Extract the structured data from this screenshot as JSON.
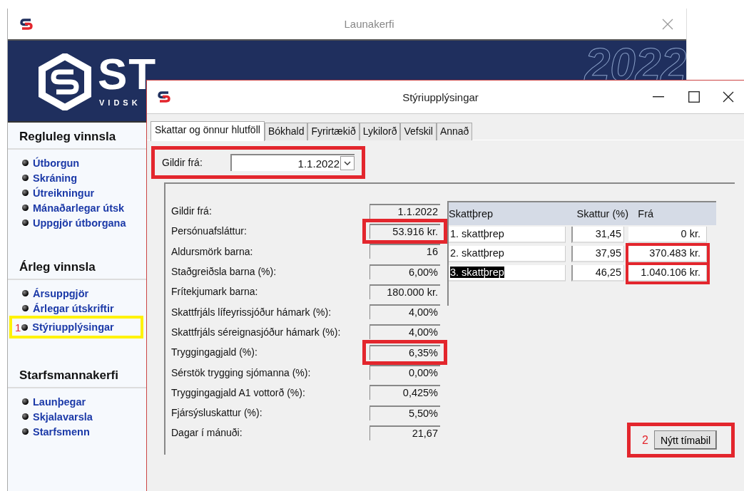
{
  "main_window": {
    "title": "Launakerfi"
  },
  "banner": {
    "brand": "ST",
    "tagline": "VIDSK",
    "year": "2022"
  },
  "sidebar": {
    "sections": [
      {
        "heading": "Regluleg vinnsla",
        "items": [
          {
            "label": "Útborgun"
          },
          {
            "label": "Skráning"
          },
          {
            "label": "Útreikningur"
          },
          {
            "label": "Mánaðarlegar útsk"
          },
          {
            "label": "Uppgjör útborgana"
          }
        ]
      },
      {
        "heading": "Árleg vinnsla",
        "items": [
          {
            "label": "Ársuppgjör"
          },
          {
            "label": "Árlegar útskriftir"
          },
          {
            "label": "Stýriupplýsingar",
            "callout": "1",
            "highlighted": true
          }
        ]
      },
      {
        "heading": "Starfsmannakerfi",
        "items": [
          {
            "label": "Launþegar"
          },
          {
            "label": "Skjalavarsla"
          },
          {
            "label": "Starfsmenn"
          }
        ]
      }
    ]
  },
  "dialog": {
    "title": "Stýriupplýsingar",
    "tabs": [
      {
        "label": "Skattar og önnur hlutföll",
        "selected": true
      },
      {
        "label": "Bókhald",
        "selected": false
      },
      {
        "label": "Fyrirtækið",
        "selected": false
      },
      {
        "label": "Lykilorð",
        "selected": false
      },
      {
        "label": "Vefskil",
        "selected": false
      },
      {
        "label": "Annað",
        "selected": false
      }
    ],
    "valid_from": {
      "label": "Gildir frá:",
      "value": "1.1.2022",
      "highlighted": true
    },
    "fields": [
      {
        "label": "Gildir frá:",
        "value": "1.1.2022"
      },
      {
        "label": "Persónuafsláttur:",
        "value": "53.916 kr.",
        "highlighted": true
      },
      {
        "label": "Aldursmörk barna:",
        "value": "16"
      },
      {
        "label": "Staðgreiðsla barna (%):",
        "value": "6,00%"
      },
      {
        "label": "Frítekjumark barna:",
        "value": "180.000 kr."
      },
      {
        "label": "Skattfrjáls lífeyrissjóður hámark (%):",
        "value": "4,00%"
      },
      {
        "label": "Skattfrjáls séreignasjóður hámark (%):",
        "value": "4,00%"
      },
      {
        "label": "Tryggingagjald (%):",
        "value": "6,35%",
        "highlighted": true
      },
      {
        "label": "Sérstök trygging sjómanna (%):",
        "value": "0,00%"
      },
      {
        "label": "Tryggingagjald A1 vottorð (%):",
        "value": "0,425%"
      },
      {
        "label": "Fjársýsluskattur (%):",
        "value": "5,50%"
      },
      {
        "label": "Dagar í mánuði:",
        "value": "21,67"
      }
    ],
    "tax_table": {
      "columns": [
        "Skattþrep",
        "Skattur (%)",
        "Frá"
      ],
      "rows": [
        {
          "name": "1. skattþrep",
          "rate": "31,45",
          "from": "0 kr.",
          "selected": false
        },
        {
          "name": "2. skattþrep",
          "rate": "37,95",
          "from": "370.483 kr.",
          "from_highlighted": true,
          "selected": false
        },
        {
          "name": "3. skattþrep",
          "rate": "46,25",
          "from": "1.040.106 kr.",
          "from_highlighted": true,
          "selected": true
        }
      ]
    },
    "new_period_button": {
      "label": "Nýtt tímabil",
      "callout": "2",
      "highlighted": true
    }
  }
}
